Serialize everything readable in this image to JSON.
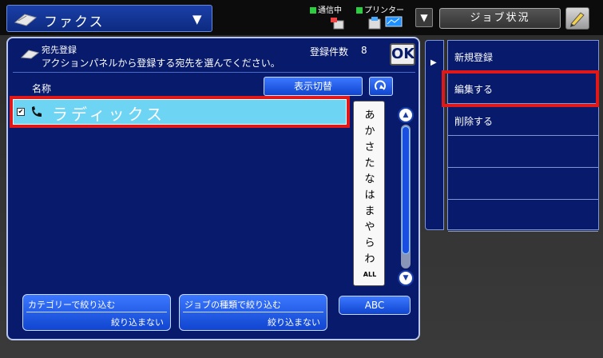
{
  "header": {
    "mode_label": "ファクス",
    "status_comm": "通信中",
    "status_printer": "プリンター",
    "job_status_label": "ジョブ状況"
  },
  "panel": {
    "title": "宛先登録",
    "subtitle": "アクションパネルから登録する宛先を選んでください。",
    "count_label": "登録件数",
    "count_value": "8",
    "ok_label": "OK",
    "column_name": "名称",
    "display_toggle_label": "表示切替"
  },
  "list": {
    "items": [
      {
        "name": "ラディックス",
        "icon": "phone-icon",
        "checked": true
      }
    ]
  },
  "kana_index": [
    "あ",
    "か",
    "さ",
    "た",
    "な",
    "は",
    "ま",
    "や",
    "ら",
    "わ",
    "ALL"
  ],
  "filters": {
    "category": {
      "title": "カテゴリーで絞り込む",
      "value": "絞り込まない"
    },
    "job_type": {
      "title": "ジョブの種類で絞り込む",
      "value": "絞り込まない"
    },
    "abc_label": "ABC"
  },
  "actions": [
    {
      "label": "新規登録"
    },
    {
      "label": "編集する"
    },
    {
      "label": "削除する"
    },
    {
      "label": ""
    },
    {
      "label": ""
    },
    {
      "label": ""
    }
  ],
  "colors": {
    "panel_bg": "#081a6b",
    "button_blue": "#1a4ee0",
    "selected_row": "#6ed4f4",
    "highlight_red": "#e01818"
  }
}
